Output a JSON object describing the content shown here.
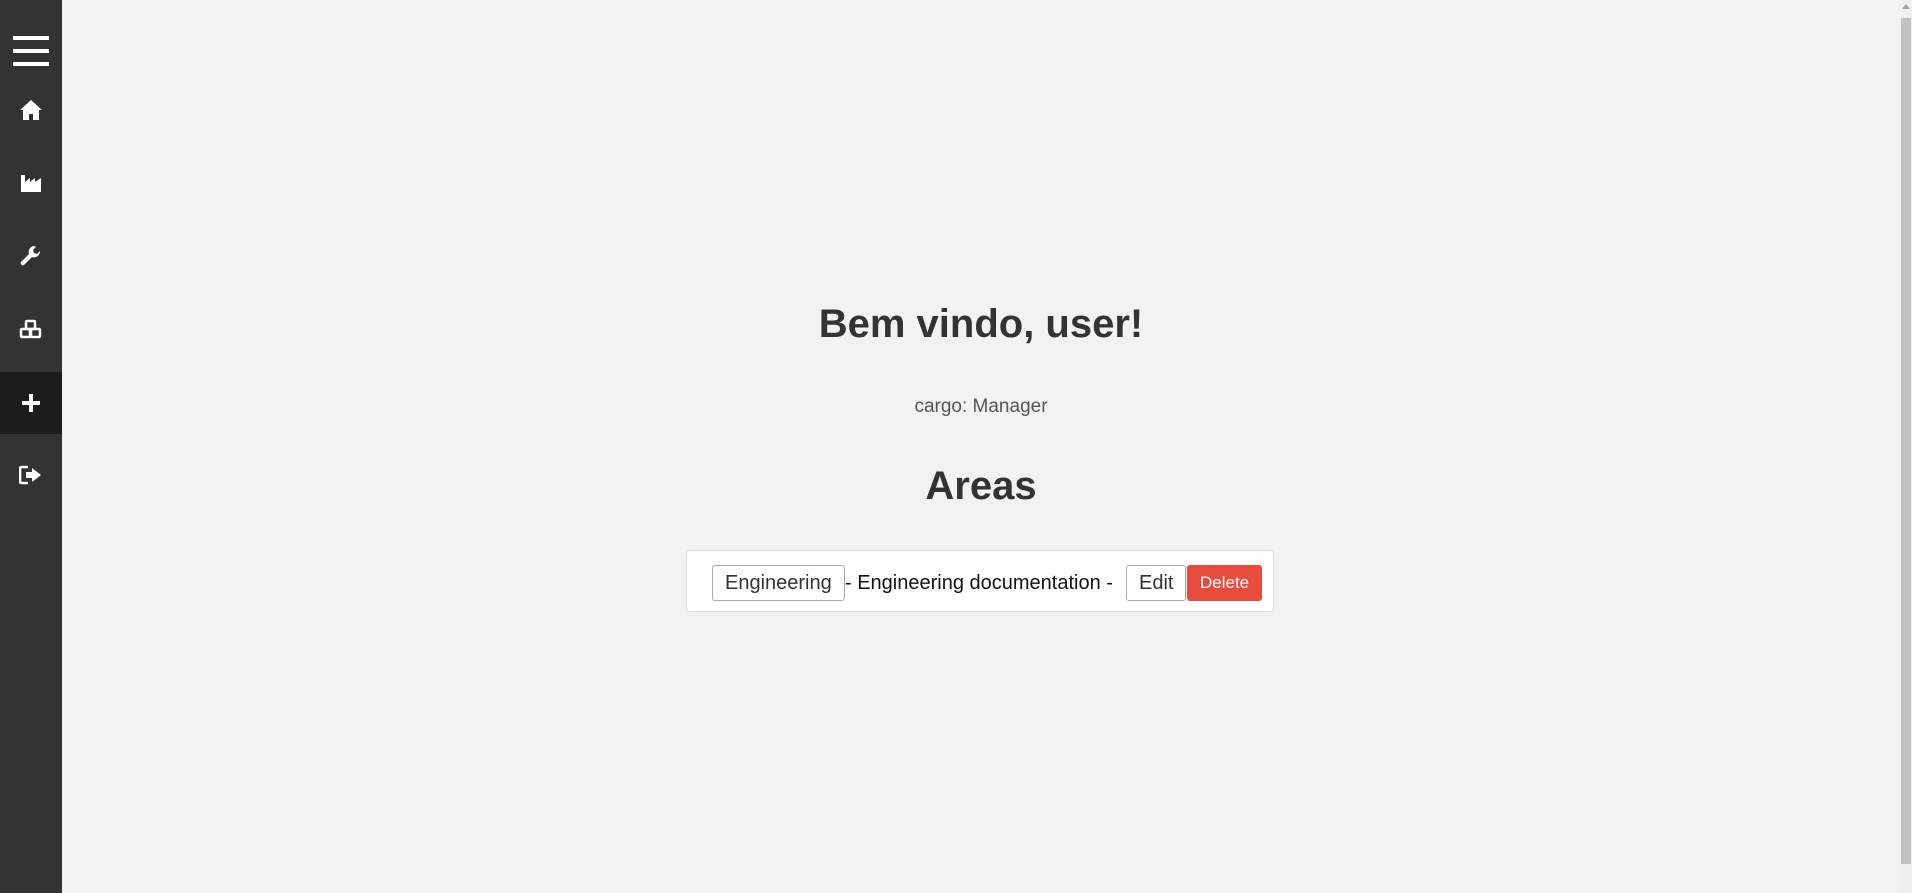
{
  "sidebar": {
    "items": [
      {
        "icon": "menu-icon"
      },
      {
        "icon": "home-icon"
      },
      {
        "icon": "factory-icon"
      },
      {
        "icon": "wrench-icon"
      },
      {
        "icon": "cubes-icon"
      },
      {
        "icon": "plus-icon",
        "active": true
      },
      {
        "icon": "sign-out-icon"
      }
    ]
  },
  "main": {
    "welcome": "Bem vindo, user!",
    "role": "cargo: Manager",
    "areas_title": "Areas",
    "areas": [
      {
        "name": "Engineering",
        "description": "- Engineering documentation -",
        "edit_label": "Edit",
        "delete_label": "Delete"
      }
    ]
  },
  "colors": {
    "sidebar_bg": "#333333",
    "sidebar_active_bg": "#1c1c1c",
    "page_bg": "#f2f2f2",
    "delete_bg": "#e74c3c"
  }
}
